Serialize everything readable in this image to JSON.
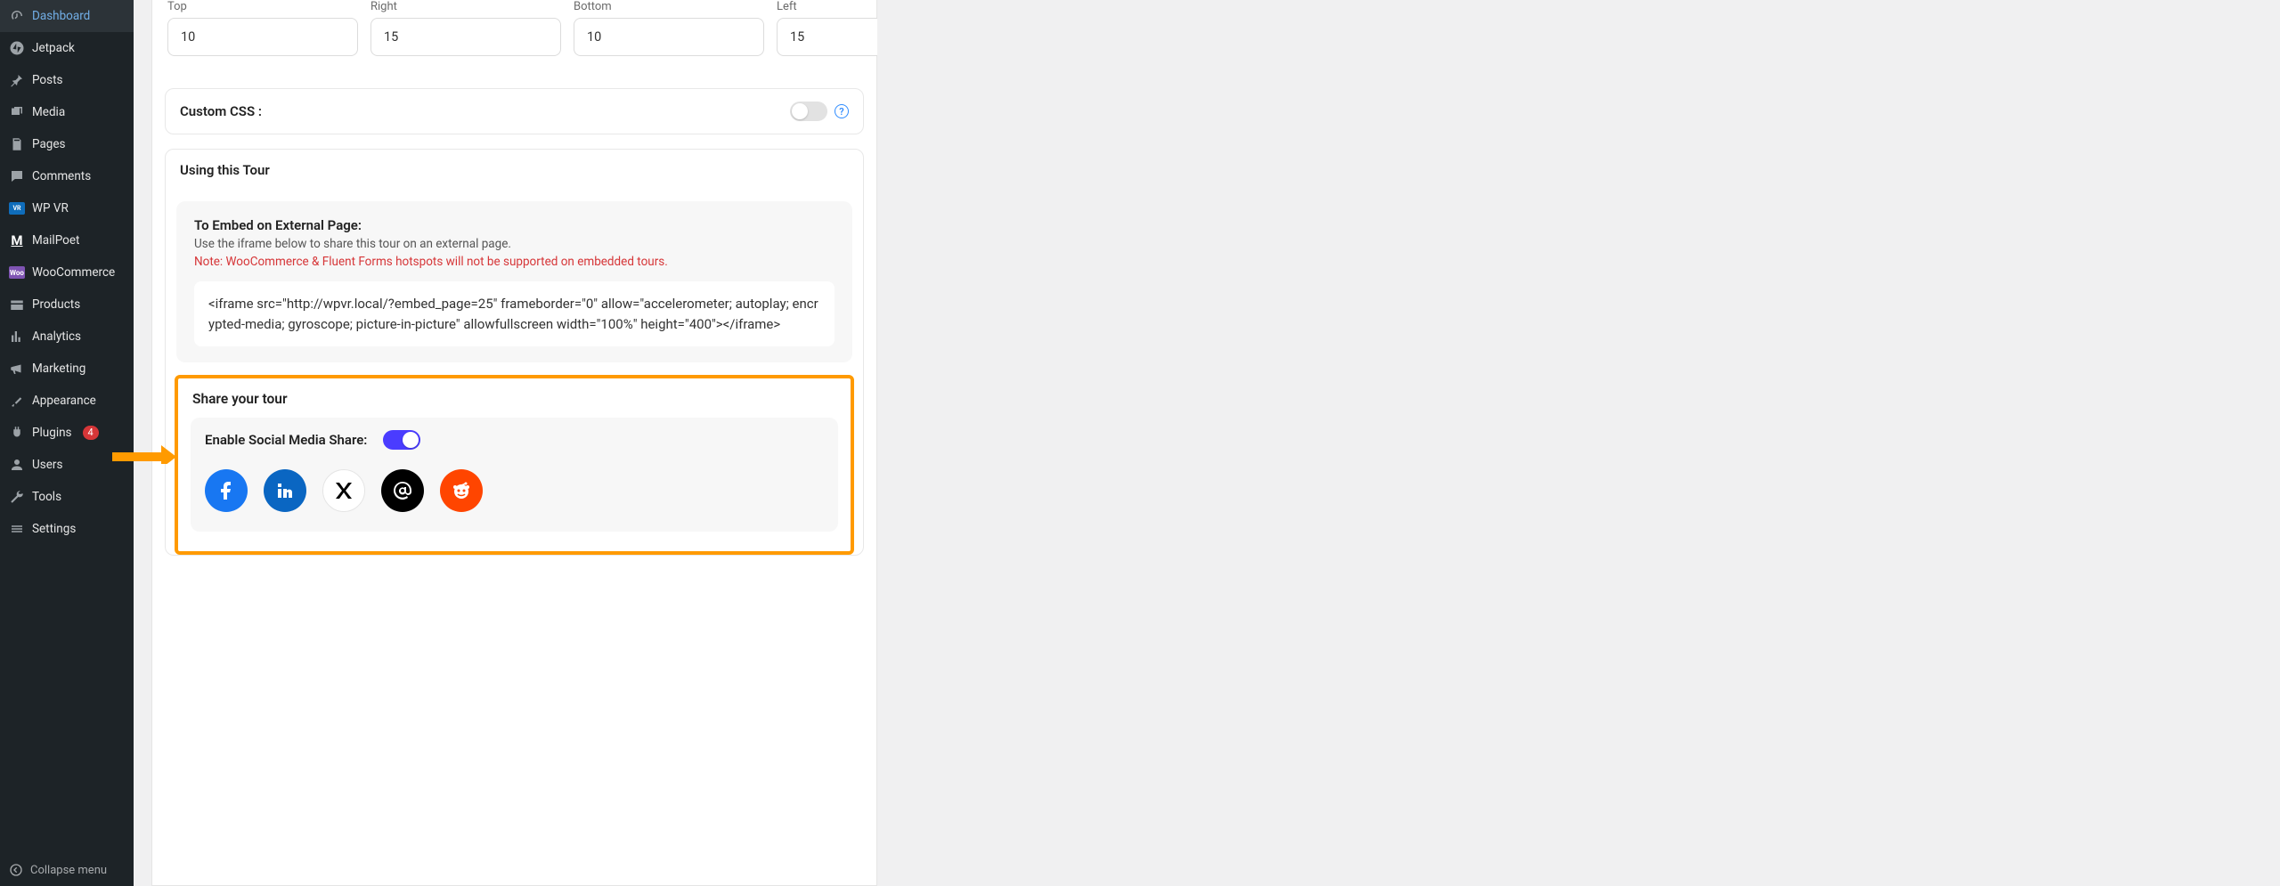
{
  "sidebar": {
    "items": [
      {
        "label": "Dashboard"
      },
      {
        "label": "Jetpack"
      },
      {
        "label": "Posts"
      },
      {
        "label": "Media"
      },
      {
        "label": "Pages"
      },
      {
        "label": "Comments"
      },
      {
        "label": "WP VR"
      },
      {
        "label": "MailPoet"
      },
      {
        "label": "WooCommerce"
      },
      {
        "label": "Products"
      },
      {
        "label": "Analytics"
      },
      {
        "label": "Marketing"
      },
      {
        "label": "Appearance"
      },
      {
        "label": "Plugins",
        "badge": "4"
      },
      {
        "label": "Users"
      },
      {
        "label": "Tools"
      },
      {
        "label": "Settings"
      }
    ],
    "collapse": "Collapse menu"
  },
  "padding": {
    "top": {
      "label": "Top",
      "value": "10"
    },
    "right": {
      "label": "Right",
      "value": "15"
    },
    "bottom": {
      "label": "Bottom",
      "value": "10"
    },
    "left": {
      "label": "Left",
      "value": "15"
    }
  },
  "customcss": {
    "label": "Custom CSS :"
  },
  "tour": {
    "head": "Using this Tour",
    "embed_title": "To Embed on External Page:",
    "embed_desc": "Use the iframe below to share this tour on an external page.",
    "embed_note": "Note: WooCommerce & Fluent Forms hotspots will not be supported on embedded tours.",
    "iframe": "<iframe src=\"http://wpvr.local/?embed_page=25\" frameborder=\"0\" allow=\"accelerometer; autoplay; encrypted-media; gyroscope; picture-in-picture\" allowfullscreen width=\"100%\" height=\"400\"></iframe>"
  },
  "share": {
    "title": "Share your tour",
    "enable": "Enable Social Media Share:"
  }
}
